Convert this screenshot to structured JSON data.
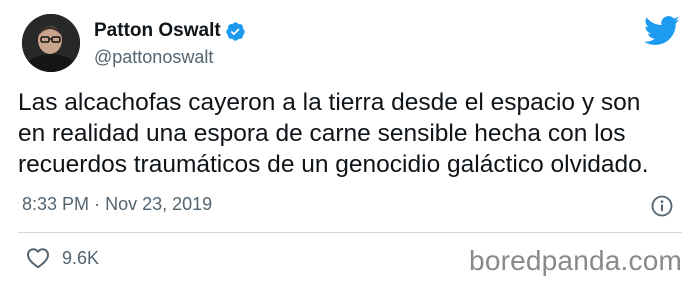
{
  "author": {
    "display_name": "Patton Oswalt",
    "handle": "@pattonoswalt",
    "verified": true
  },
  "tweet": {
    "lines": [
      "Las alcachofas cayeron a la tierra desde el espacio y son",
      "en realidad una espora de carne sensible hecha con los",
      "recuerdos traumáticos de un genocidio galáctico olvidado."
    ],
    "time": "8:33 PM",
    "separator": "·",
    "date": "Nov 23, 2019"
  },
  "engagement": {
    "likes": "9.6K"
  },
  "watermark": "boredpanda.com",
  "icons": {
    "verified": "verified-badge-icon",
    "brand": "twitter-bird-icon",
    "info": "info-icon",
    "like": "heart-icon"
  },
  "colors": {
    "brand_blue": "#1d9bf0",
    "text": "#0f1419",
    "secondary_text": "#536471",
    "divider": "#cfd9de",
    "watermark": "#8a8a8a"
  }
}
